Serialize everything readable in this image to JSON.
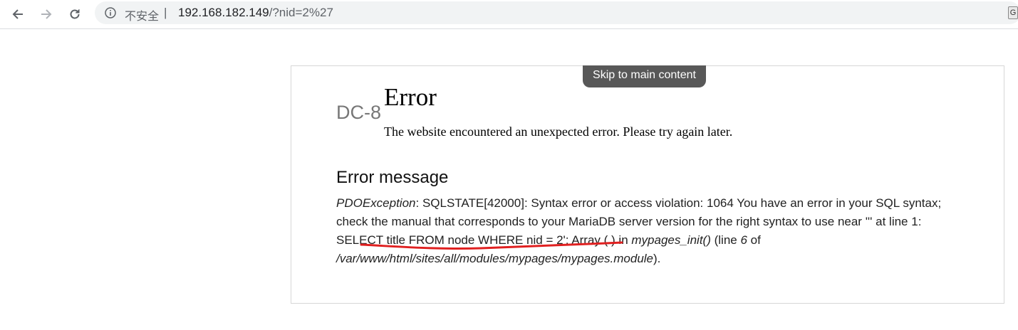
{
  "browser": {
    "security_label": "不安全",
    "separator": "|",
    "url_host": "192.168.182.149",
    "url_path": "/?nid=2%27",
    "extension_glyph": "G",
    "icons": [
      "back-arrow-icon",
      "forward-arrow-icon",
      "reload-icon",
      "info-icon"
    ]
  },
  "page": {
    "skip_link": "Skip to main content",
    "site_name": "DC-8",
    "error_title": "Error",
    "error_text": "The website encountered an unexpected error. Please try again later.",
    "message_heading": "Error message",
    "message": {
      "exception": "PDOException",
      "text_1": ": SQLSTATE[42000]: Syntax error or access violation: 1064 You have an error in your SQL syntax; check the manual that corresponds to your MariaDB server version for the right syntax to use near ''' at line 1: SELECT title FROM node WHERE nid = 2'; Array ( ) in ",
      "function": "mypages_init()",
      "text_2": " (line ",
      "line_number": "6",
      "text_3": " of ",
      "file_path": "/var/www/html/sites/all/modules/mypages/mypages.module",
      "text_4": ")."
    },
    "annotation_color": "#e02020"
  }
}
